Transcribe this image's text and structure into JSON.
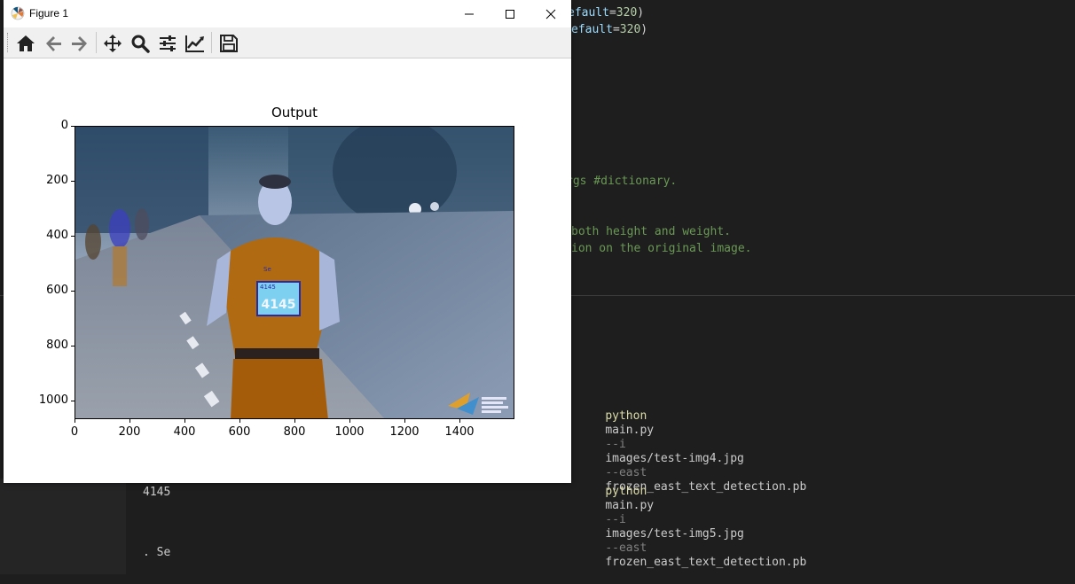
{
  "editor": {
    "lines": [
      {
        "parts": [
          {
            "t": "efault",
            "c": "kw"
          },
          {
            "t": "=",
            "c": "default"
          },
          {
            "t": "320",
            "c": "num"
          },
          {
            "t": ")",
            "c": "default"
          }
        ]
      },
      {
        "parts": [
          {
            "t": "efault",
            "c": "kw"
          },
          {
            "t": "=",
            "c": "default"
          },
          {
            "t": "320",
            "c": "num"
          },
          {
            "t": ")",
            "c": "default"
          }
        ]
      },
      {
        "parts": [
          {
            "t": "rgs #dictionary.",
            "c": "comment"
          }
        ]
      },
      {
        "parts": [
          {
            "t": "both height and weight.",
            "c": "comment"
          }
        ]
      },
      {
        "parts": [
          {
            "t": "ion on the original image.",
            "c": "comment"
          }
        ]
      }
    ]
  },
  "terminal": {
    "commands": [
      {
        "cmd": "python",
        "script": "main.py",
        "flag1": "--i",
        "arg1": "images/test-img4.jpg",
        "flag2": "--east",
        "arg2": "frozen_east_text_detection.pb"
      },
      {
        "cmd": "python",
        "script": "main.py",
        "flag1": "--i",
        "arg1": "images/test-img5.jpg",
        "flag2": "--east",
        "arg2": "frozen_east_text_detection.pb"
      }
    ],
    "output1": "4145",
    "output2": ". Se"
  },
  "figure": {
    "window_title": "Figure 1",
    "toolbar": {
      "home": "home-icon",
      "back": "arrow-left-icon",
      "forward": "arrow-right-icon",
      "pan": "move-icon",
      "zoom": "magnifier-icon",
      "subplots": "sliders-icon",
      "axes": "line-chart-icon",
      "save": "floppy-disk-icon"
    },
    "image_labels": {
      "bib": "4145",
      "small": "Se",
      "bib_small": "4145"
    }
  },
  "chart_data": {
    "type": "image",
    "title": "Output",
    "xlabel": "",
    "ylabel": "",
    "xlim": [
      0,
      1600
    ],
    "ylim": [
      1067,
      0
    ],
    "xticks": [
      "0",
      "200",
      "400",
      "600",
      "800",
      "1000",
      "1200",
      "1400"
    ],
    "xtick_values": [
      0,
      200,
      400,
      600,
      800,
      1000,
      1200,
      1400
    ],
    "yticks": [
      "0",
      "200",
      "400",
      "600",
      "800",
      "1000"
    ],
    "ytick_values": [
      0,
      200,
      400,
      600,
      800,
      1000
    ],
    "grid": false
  }
}
